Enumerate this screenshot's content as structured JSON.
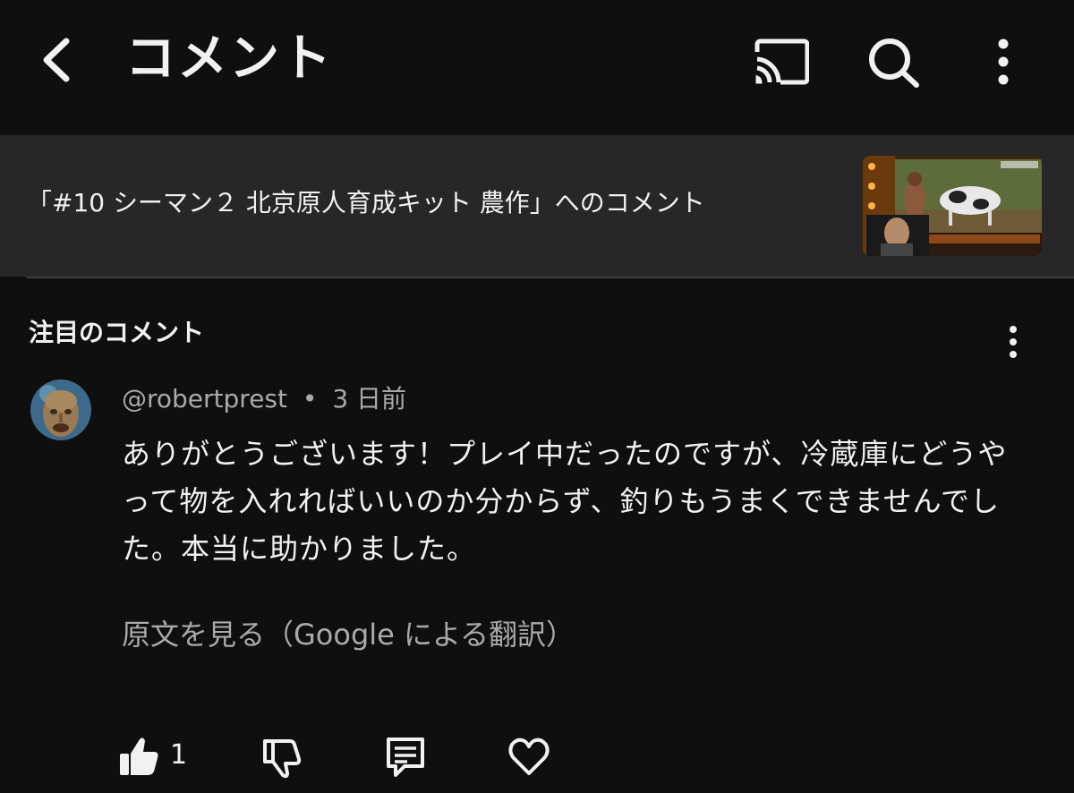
{
  "header": {
    "title": "コメント",
    "icons": [
      "back-arrow-icon",
      "cast-icon",
      "search-icon",
      "more-vert-icon"
    ]
  },
  "video": {
    "title": "「#10 シーマン２ 北京原人育成キット 農作」へのコメント"
  },
  "section": {
    "title": "注目のコメント"
  },
  "comment": {
    "author": "@robertprest",
    "separator": "•",
    "time": "3 日前",
    "text": "ありがとうございます！プレイ中だったのですが、冷蔵庫にどうやって物を入れればいいのか分からず、釣りもうまくできませんでした。本当に助かりました。",
    "translation_link": "原文を見る（Google による翻訳）",
    "like_count": "1"
  },
  "colors": {
    "background": "#0f0f0f",
    "banner": "#272727",
    "text": "#f1f1f1",
    "secondary_text": "#aaaaaa"
  }
}
